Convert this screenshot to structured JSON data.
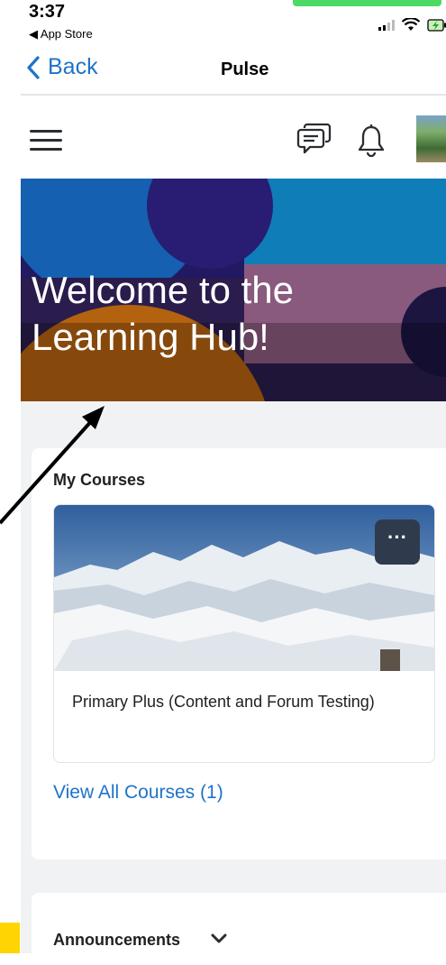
{
  "status_bar": {
    "time": "3:37",
    "back_app": "◀ App Store"
  },
  "nav": {
    "back_label": "Back",
    "title": "Pulse"
  },
  "header": {
    "icons": [
      "menu-icon",
      "chat-icon",
      "bell-icon",
      "avatar"
    ]
  },
  "banner": {
    "line1": "Welcome to the",
    "line2": "Learning Hub!"
  },
  "my_courses": {
    "title": "My Courses",
    "course_name": "Primary Plus (Content and Forum Testing)",
    "more_label": "···",
    "view_all": "View All Courses (1)"
  },
  "announcements": {
    "title": "Announcements"
  },
  "colors": {
    "link": "#1e73c8",
    "content_bg": "#f1f2f3",
    "status_green": "#4cd964"
  }
}
